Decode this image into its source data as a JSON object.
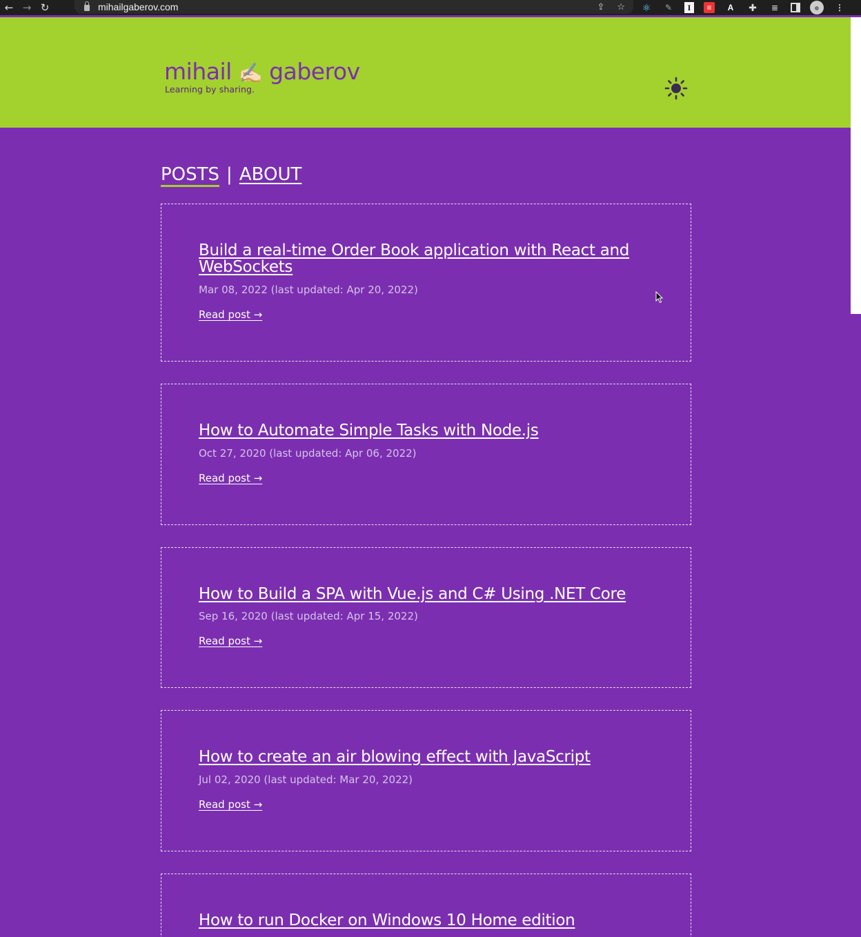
{
  "browser": {
    "url": "mihailgaberov.com",
    "ext_info": "I",
    "ext_a": "A"
  },
  "header": {
    "logo_first": "mihail",
    "logo_emoji": "✍🏻",
    "logo_last": "gaberov",
    "tagline": "Learning by sharing."
  },
  "nav": {
    "posts": "POSTS",
    "separator": "|",
    "about": "ABOUT"
  },
  "posts": [
    {
      "title": "Build a real-time Order Book application with React and WebSockets",
      "date": "Mar 08, 2022 (last updated: Apr 20, 2022)",
      "read": "Read post →"
    },
    {
      "title": "How to Automate Simple Tasks with Node.js",
      "date": "Oct 27, 2020 (last updated: Apr 06, 2022)",
      "read": "Read post →"
    },
    {
      "title": "How to Build a SPA with Vue.js and C# Using .NET Core",
      "date": "Sep 16, 2020 (last updated: Apr 15, 2022)",
      "read": "Read post →"
    },
    {
      "title": "How to create an air blowing effect with JavaScript",
      "date": "Jul 02, 2020 (last updated: Mar 20, 2022)",
      "read": "Read post →"
    },
    {
      "title": "How to run Docker on Windows 10 Home edition"
    }
  ],
  "colors": {
    "page_bg": "#7b2fb0",
    "header_bg": "#a3d12d",
    "logo": "#7b2fb0"
  }
}
